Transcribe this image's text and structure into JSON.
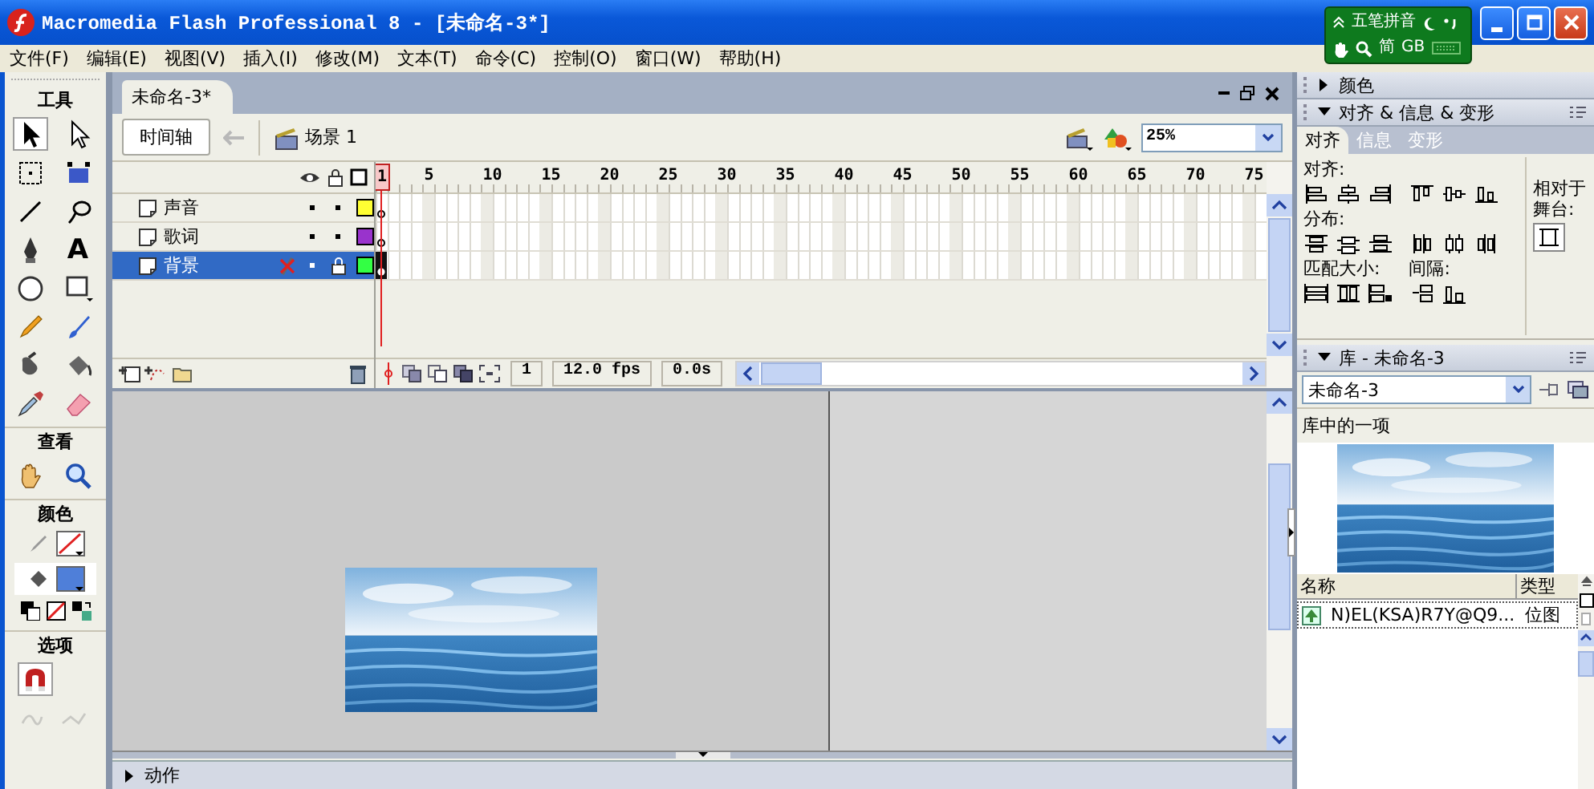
{
  "window": {
    "title": "Macromedia Flash Professional 8 - [未命名-3*]"
  },
  "ime_bar": {
    "mode": "五笔拼音",
    "script": "简",
    "encoding": "GB"
  },
  "menu": [
    "文件(F)",
    "编辑(E)",
    "视图(V)",
    "插入(I)",
    "修改(M)",
    "文本(T)",
    "命令(C)",
    "控制(O)",
    "窗口(W)",
    "帮助(H)"
  ],
  "toolbox": {
    "title": "工具",
    "tools": [
      {
        "kind": "selection",
        "selected": true
      },
      {
        "kind": "subselection",
        "selected": false
      },
      {
        "kind": "freetransform",
        "selected": false
      },
      {
        "kind": "filltransform",
        "selected": false
      },
      {
        "kind": "line",
        "selected": false
      },
      {
        "kind": "lasso",
        "selected": false
      },
      {
        "kind": "pen",
        "selected": false
      },
      {
        "kind": "text",
        "glyph": "A",
        "selected": false
      },
      {
        "kind": "oval",
        "selected": false
      },
      {
        "kind": "rectangle",
        "selected": false
      },
      {
        "kind": "pencil",
        "selected": false
      },
      {
        "kind": "brush",
        "selected": false
      },
      {
        "kind": "inkbottle",
        "selected": false
      },
      {
        "kind": "bucket",
        "selected": false
      },
      {
        "kind": "eyedropper",
        "selected": false
      },
      {
        "kind": "eraser",
        "selected": false
      }
    ],
    "view_title": "查看",
    "view_tools": [
      {
        "kind": "hand",
        "selected": false
      },
      {
        "kind": "zoom",
        "selected": false
      }
    ],
    "colors_title": "颜色",
    "options_title": "选项",
    "options": [
      {
        "kind": "snap",
        "on": true,
        "disabled": false
      },
      {
        "kind": "smooth",
        "on": false,
        "disabled": true
      },
      {
        "kind": "straighten",
        "on": false,
        "disabled": true
      }
    ]
  },
  "document": {
    "tab": "未命名-3*",
    "timeline_button": "时间轴",
    "scene": "场景 1",
    "zoom": "25%"
  },
  "timeline": {
    "ruler": [
      "1",
      "5",
      "10",
      "15",
      "20",
      "25",
      "30",
      "35",
      "40",
      "45",
      "50",
      "55",
      "60",
      "65",
      "70",
      "75"
    ],
    "layers": [
      {
        "name": "声音",
        "selected": false,
        "locked": false,
        "color": "#ffff33",
        "keyframe_filled": false
      },
      {
        "name": "歌词",
        "selected": false,
        "locked": false,
        "color": "#9933cc",
        "keyframe_filled": false
      },
      {
        "name": "背景",
        "selected": true,
        "locked": true,
        "color": "#33ff44",
        "keyframe_filled": true
      }
    ],
    "current_frame": "1",
    "frame_rate": "12.0 fps",
    "elapsed_time": "0.0s"
  },
  "panels": {
    "color": {
      "title": "颜色",
      "expanded": false
    },
    "align": {
      "title": "对齐 & 信息 & 变形",
      "expanded": true,
      "tabs": [
        {
          "label": "对齐",
          "selected": true
        },
        {
          "label": "信息",
          "selected": false
        },
        {
          "label": "变形",
          "selected": false
        }
      ],
      "align_label": "对齐:",
      "distribute_label": "分布:",
      "match_size_label": "匹配大小:",
      "spacing_label": "间隔:",
      "stage_label": "相对于舞台:"
    },
    "library": {
      "title": "库 - 未命名-3",
      "expanded": true,
      "document": "未命名-3",
      "count": "库中的一项",
      "columns": [
        "名称",
        "类型"
      ],
      "items": [
        {
          "name": "N)EL(KSA)R7Y@Q9...",
          "type": "位图"
        }
      ]
    },
    "actions": {
      "title": "动作",
      "expanded": false
    }
  }
}
